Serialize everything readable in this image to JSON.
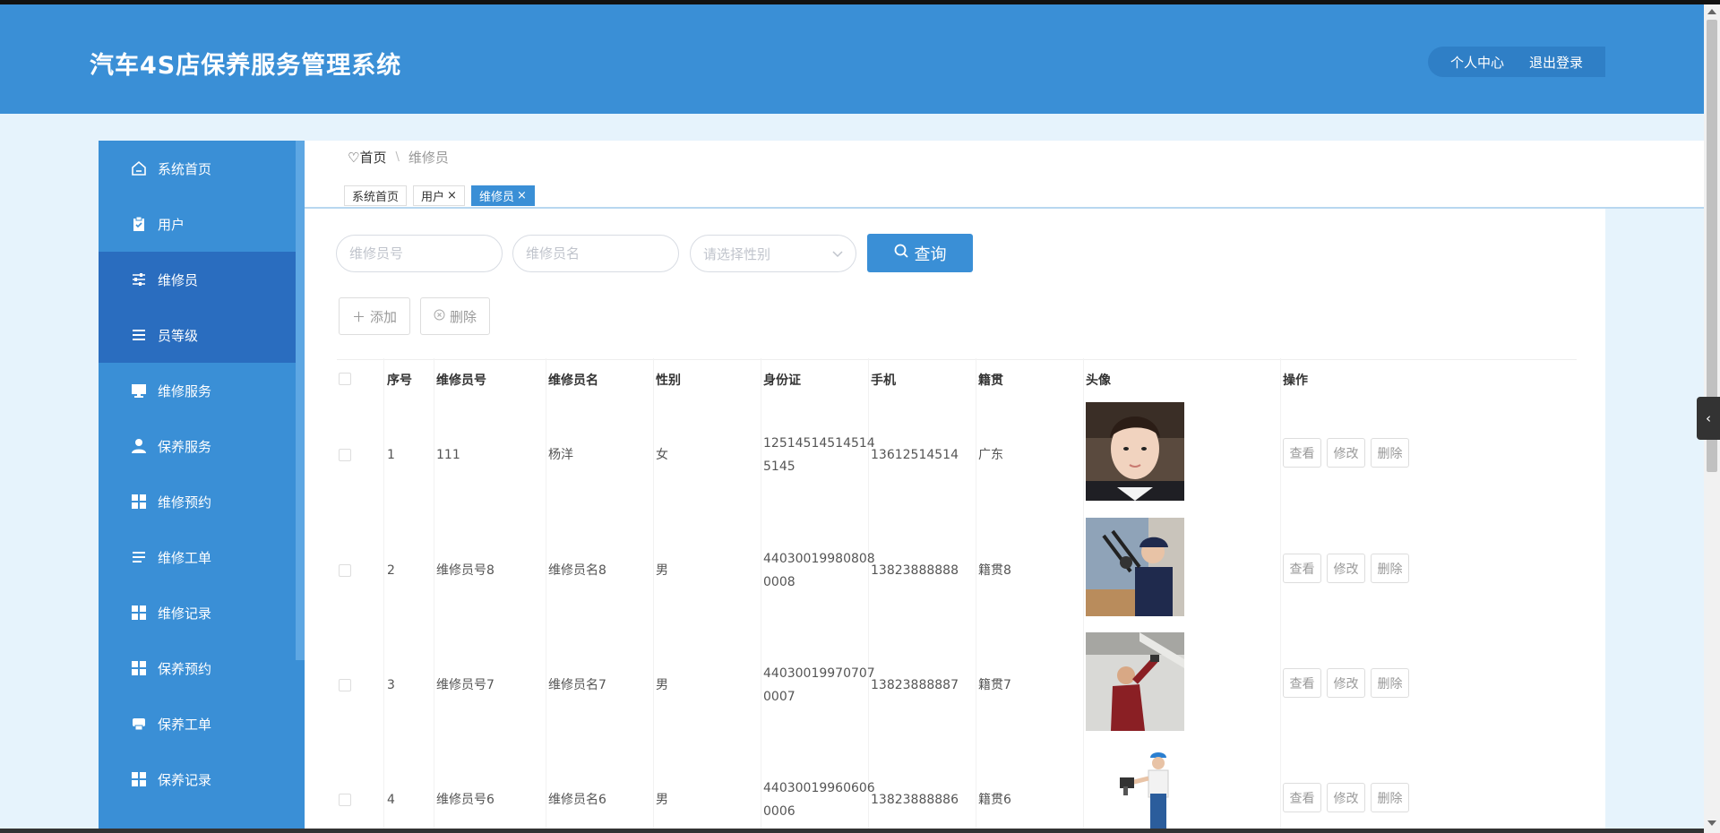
{
  "header": {
    "app_title": "汽车4S店保养服务管理系统",
    "personal_center": "个人中心",
    "logout": "退出登录"
  },
  "sidebar": {
    "items": [
      {
        "label": "系统首页",
        "icon": "home-icon",
        "active": false
      },
      {
        "label": "用户",
        "icon": "clipboard-icon",
        "active": false
      },
      {
        "label": "维修员",
        "icon": "sliders-icon",
        "active": true
      },
      {
        "label": "员等级",
        "icon": "list-icon",
        "active": true
      },
      {
        "label": "维修服务",
        "icon": "monitor-icon",
        "active": false
      },
      {
        "label": "保养服务",
        "icon": "user-icon",
        "active": false
      },
      {
        "label": "维修预约",
        "icon": "grid-icon",
        "active": false
      },
      {
        "label": "维修工单",
        "icon": "list-icon",
        "active": false
      },
      {
        "label": "维修记录",
        "icon": "grid-icon",
        "active": false
      },
      {
        "label": "保养预约",
        "icon": "grid-icon",
        "active": false
      },
      {
        "label": "保养工单",
        "icon": "printer-icon",
        "active": false
      },
      {
        "label": "保养记录",
        "icon": "grid-icon",
        "active": false
      }
    ]
  },
  "breadcrumb": {
    "home": "首页",
    "separator": "\\",
    "current": "维修员"
  },
  "tabs": [
    {
      "label": "系统首页",
      "closable": false,
      "active": false
    },
    {
      "label": "用户",
      "closable": true,
      "active": false
    },
    {
      "label": "维修员",
      "closable": true,
      "active": true
    }
  ],
  "tab_close": "×",
  "search": {
    "id_placeholder": "维修员号",
    "name_placeholder": "维修员名",
    "gender_placeholder": "请选择性别",
    "query_label": "查询"
  },
  "actions": {
    "add_label": "添加",
    "delete_label": "删除"
  },
  "table": {
    "headers": {
      "index": "序号",
      "staff_no": "维修员号",
      "staff_name": "维修员名",
      "gender": "性别",
      "id_card": "身份证",
      "phone": "手机",
      "native": "籍贯",
      "avatar": "头像",
      "ops": "操作"
    },
    "op_labels": {
      "view": "查看",
      "edit": "修改",
      "delete": "删除"
    },
    "rows": [
      {
        "index": "1",
        "staff_no": "111",
        "staff_name": "杨洋",
        "gender": "女",
        "id_line1": "12514514514514",
        "id_line2": "5145",
        "phone": "13612514514",
        "native": "广东"
      },
      {
        "index": "2",
        "staff_no": "维修员号8",
        "staff_name": "维修员名8",
        "gender": "男",
        "id_line1": "44030019980808",
        "id_line2": "0008",
        "phone": "13823888888",
        "native": "籍贯8"
      },
      {
        "index": "3",
        "staff_no": "维修员号7",
        "staff_name": "维修员名7",
        "gender": "男",
        "id_line1": "44030019970707",
        "id_line2": "0007",
        "phone": "13823888887",
        "native": "籍贯7"
      },
      {
        "index": "4",
        "staff_no": "维修员号6",
        "staff_name": "维修员名6",
        "gender": "男",
        "id_line1": "44030019960606",
        "id_line2": "0006",
        "phone": "13823888886",
        "native": "籍贯6"
      }
    ]
  },
  "colors": {
    "primary": "#3a8fd6",
    "sidebar_active": "#2a6dbf",
    "page_bg": "#e6f3fc"
  }
}
